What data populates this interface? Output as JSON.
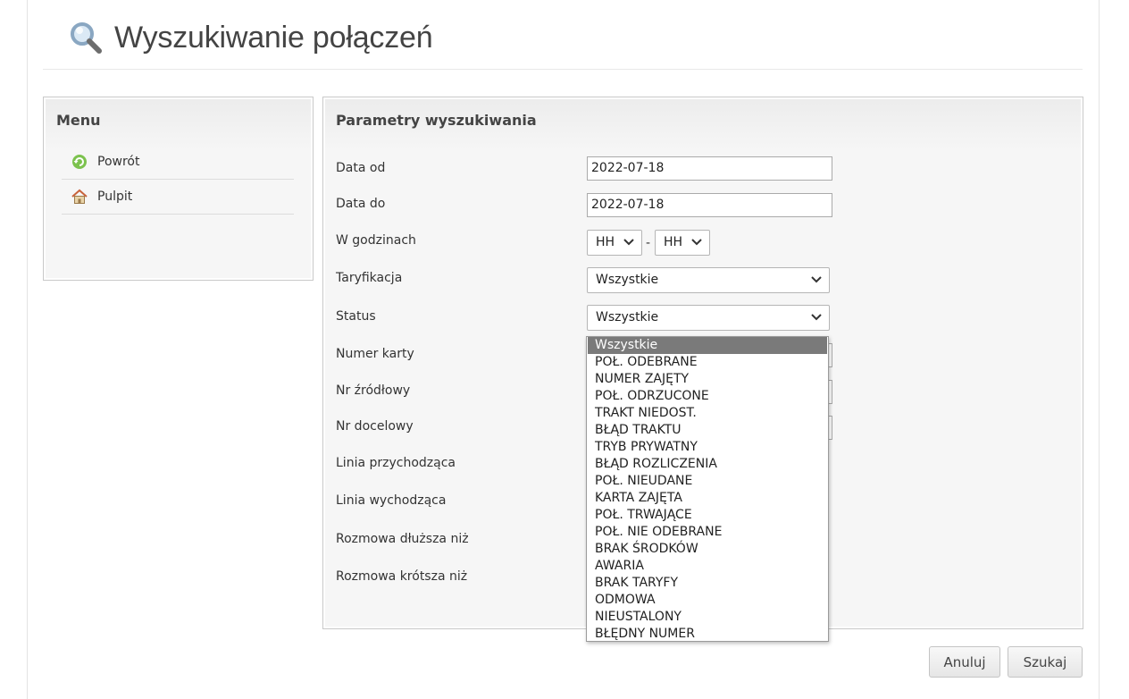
{
  "header": {
    "title": "Wyszukiwanie połączeń",
    "icon": "magnifier-icon"
  },
  "menu": {
    "title": "Menu",
    "items": [
      {
        "label": "Powrót",
        "icon": "back-arrow-icon"
      },
      {
        "label": "Pulpit",
        "icon": "home-icon"
      }
    ]
  },
  "params": {
    "title": "Parametry wyszukiwania",
    "labels": {
      "date_from": "Data od",
      "date_to": "Data do",
      "hours": "W godzinach",
      "tariff": "Taryfikacja",
      "status": "Status",
      "card_number": "Numer karty",
      "source_number": "Nr źródłowy",
      "target_number": "Nr docelowy",
      "incoming_line": "Linia przychodząca",
      "outgoing_line": "Linia wychodząca",
      "longer_than": "Rozmowa dłuższa niż",
      "shorter_than": "Rozmowa krótsza niż"
    },
    "date_from_value": "2022-07-18",
    "date_to_value": "2022-07-18",
    "hour_from": "HH",
    "hour_separator": "-",
    "hour_to": "HH",
    "tariff_value": "Wszystkie",
    "status_value": "Wszystkie"
  },
  "status_dropdown": {
    "selected_index": 0,
    "options": [
      "Wszystkie",
      "POŁ. ODEBRANE",
      "NUMER ZAJĘTY",
      "POŁ. ODRZUCONE",
      "TRAKT NIEDOST.",
      "BŁĄD TRAKTU",
      "TRYB PRYWATNY",
      "BŁĄD ROZLICZENIA",
      "POŁ. NIEUDANE",
      "KARTA ZAJĘTA",
      "POŁ. TRWAJĄCE",
      "POŁ. NIE ODEBRANE",
      "BRAK ŚRODKÓW",
      "AWARIA",
      "BRAK TARYFY",
      "ODMOWA",
      "NIEUSTALONY",
      "BŁĘDNY NUMER"
    ]
  },
  "buttons": {
    "cancel": "Anuluj",
    "search": "Szukaj"
  },
  "colors": {
    "selected_option_bg": "#7a7a7a",
    "panel_border": "#c9c9c9"
  }
}
